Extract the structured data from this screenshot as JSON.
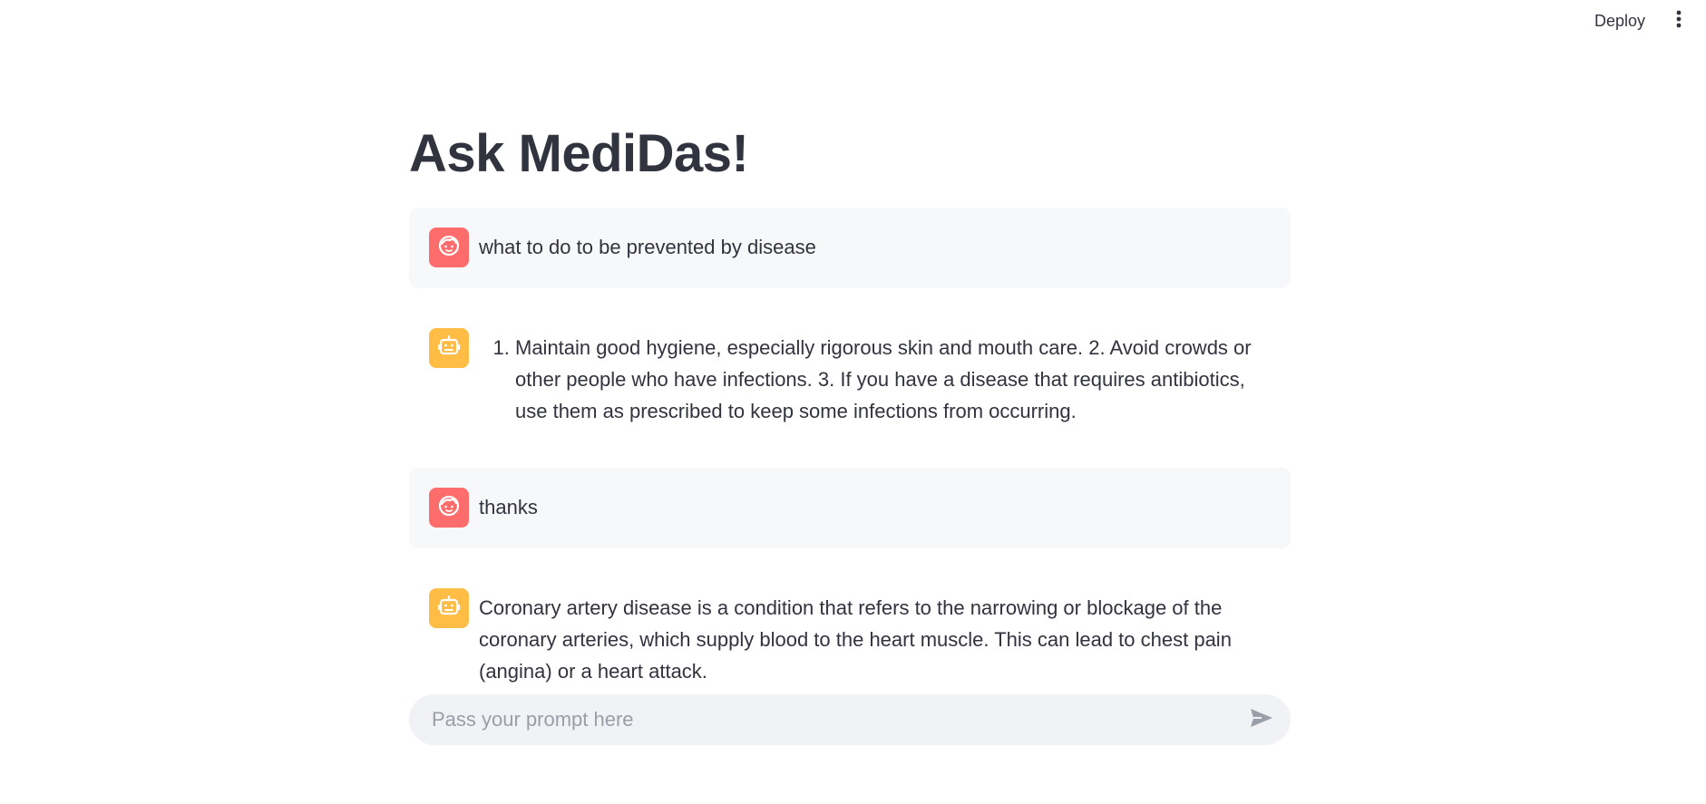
{
  "header": {
    "deploy_label": "Deploy",
    "menu_icon": "vertical-ellipsis-icon"
  },
  "main": {
    "title": "Ask MediDas!"
  },
  "messages": [
    {
      "role": "user",
      "avatar_icon": "user-face-icon",
      "text": "what to do to be prevented by disease"
    },
    {
      "role": "assistant",
      "avatar_icon": "robot-face-icon",
      "list_item": "Maintain good hygiene, especially rigorous skin and mouth care. 2. Avoid crowds or other people who have infections. 3. If you have a disease that requires antibiotics, use them as prescribed to keep some infections from occurring."
    },
    {
      "role": "user",
      "avatar_icon": "user-face-icon",
      "text": "thanks"
    },
    {
      "role": "assistant",
      "avatar_icon": "robot-face-icon",
      "text": "Coronary artery disease is a condition that refers to the narrowing or blockage of the coronary arteries, which supply blood to the heart muscle. This can lead to chest pain (angina) or a heart attack."
    }
  ],
  "chat_input": {
    "placeholder": "Pass your prompt here",
    "value": "",
    "send_icon": "send-icon"
  },
  "colors": {
    "user_avatar": "#ff6c6c",
    "assistant_avatar": "#ffbd45",
    "user_bubble_bg": "#f7f8fa",
    "input_bg": "#f0f2f6",
    "text": "#31333f"
  }
}
